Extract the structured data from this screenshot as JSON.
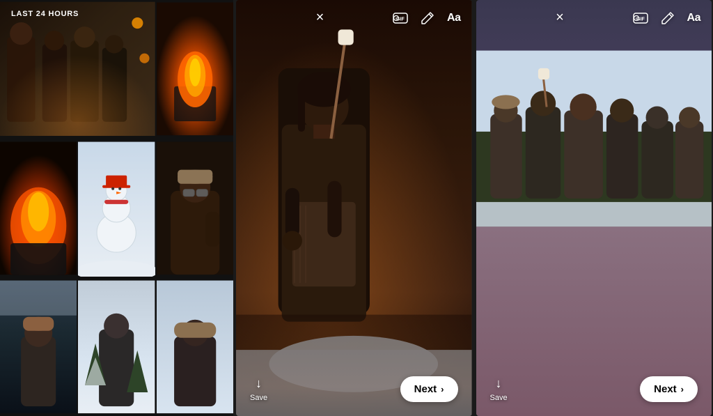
{
  "gallery": {
    "header": "LAST 24 HOURS",
    "photos": [
      {
        "id": "group-people",
        "type": "group-campfire"
      },
      {
        "id": "campfire-right",
        "type": "campfire-small"
      },
      {
        "id": "campfire-large",
        "type": "campfire-large"
      },
      {
        "id": "snowman",
        "type": "snowman"
      },
      {
        "id": "selfie",
        "type": "selfie"
      },
      {
        "id": "forest-snow",
        "type": "forest"
      },
      {
        "id": "snow-scene2",
        "type": "snow-person"
      },
      {
        "id": "bottom-mid",
        "type": "snow-landscape"
      },
      {
        "id": "bottom-right",
        "type": "snow-trees"
      }
    ]
  },
  "story1": {
    "toolbar": {
      "close_icon": "×",
      "gif_icon": "GIF",
      "pen_icon": "✏",
      "text_icon": "Aa"
    },
    "bottom": {
      "save_icon": "↓",
      "save_label": "Save",
      "next_label": "Next",
      "next_chevron": "›"
    }
  },
  "story2": {
    "toolbar": {
      "close_icon": "×",
      "gif_icon": "GIF",
      "pen_icon": "✏",
      "text_icon": "Aa"
    },
    "bottom": {
      "save_icon": "↓",
      "save_label": "Save",
      "next_label": "Next",
      "next_chevron": "›"
    }
  }
}
